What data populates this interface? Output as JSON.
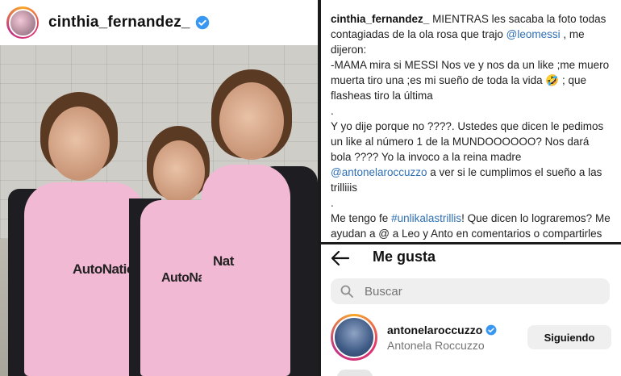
{
  "post": {
    "username": "cinthia_fernandez_",
    "verified_icon": "verified-badge-icon",
    "avatar": "profile-avatar",
    "jersey_text": [
      "AutoNatio",
      "AutoNation",
      "Nat"
    ]
  },
  "caption": {
    "username": "cinthia_fernandez_",
    "line1": "MIENTRAS les sacaba la foto todas contagiadas de la ola rosa que trajo",
    "mention1": "@leomessi",
    "line1b": ", me dijeron:",
    "line2": "-MAMA mira si MESSI Nos ve y nos da un like ;me muero muerta tiro una ;es mi sueño de toda la vida 🤣 ; que flasheas tiro la última",
    "dot1": ".",
    "line3": "Y yo dije porque no ????. Ustedes que dicen le pedimos un like al número 1 de la MUNDOOOOOO? Nos dará bola ???? Yo la invoco a la reina madre",
    "mention2": "@antonelaroccuzzo",
    "line3b": "a ver si le cumplimos el sueño a las trilliiis",
    "dot2": ".",
    "line4a": "Me tengo fe",
    "hashtag": "#unlikalastrillis",
    "line4b": "! Que dicen lo lograremos? Me ayudan a @ a Leo y Anto en comentarios o compartirles la foto? Lo lograremos? 👀....",
    "colors": {
      "link": "#2f6fb3"
    }
  },
  "likes": {
    "title": "Me gusta",
    "back_icon": "back-arrow-icon",
    "search": {
      "placeholder": "Buscar",
      "icon": "search-icon"
    },
    "users": [
      {
        "username": "antonelaroccuzzo",
        "fullname": "Antonela Roccuzzo",
        "button": "Siguiendo",
        "verified": true
      }
    ]
  }
}
